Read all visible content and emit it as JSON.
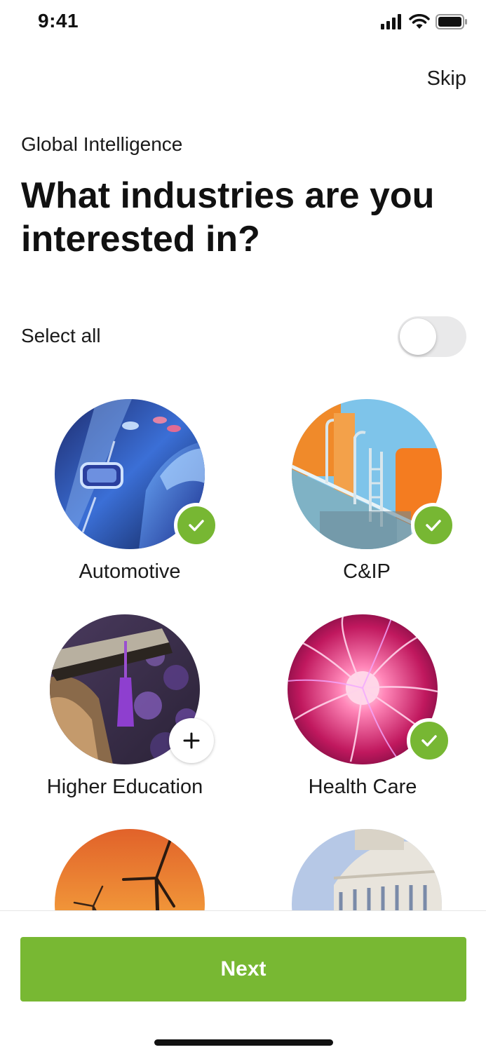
{
  "status_bar": {
    "time": "9:41",
    "icons": [
      "signal-icon",
      "wifi-icon",
      "battery-icon"
    ]
  },
  "header": {
    "skip_label": "Skip",
    "eyebrow": "Global Intelligence",
    "title": "What industries are you interested in?"
  },
  "select_all": {
    "label": "Select all",
    "enabled": false
  },
  "industries": [
    {
      "label": "Automotive",
      "selected": true,
      "image": "highway-car-image"
    },
    {
      "label": "C&IP",
      "selected": true,
      "image": "industrial-plant-image"
    },
    {
      "label": "Higher Education",
      "selected": false,
      "image": "graduation-cap-image"
    },
    {
      "label": "Health Care",
      "selected": true,
      "image": "plasma-ball-image"
    },
    {
      "label": "",
      "selected": false,
      "image": "wind-turbine-image"
    },
    {
      "label": "",
      "selected": false,
      "image": "capitol-dome-image"
    }
  ],
  "footer": {
    "next_label": "Next"
  },
  "colors": {
    "accent": "#78b833",
    "toggle_off": "#e9e9ea",
    "text": "#111111"
  }
}
